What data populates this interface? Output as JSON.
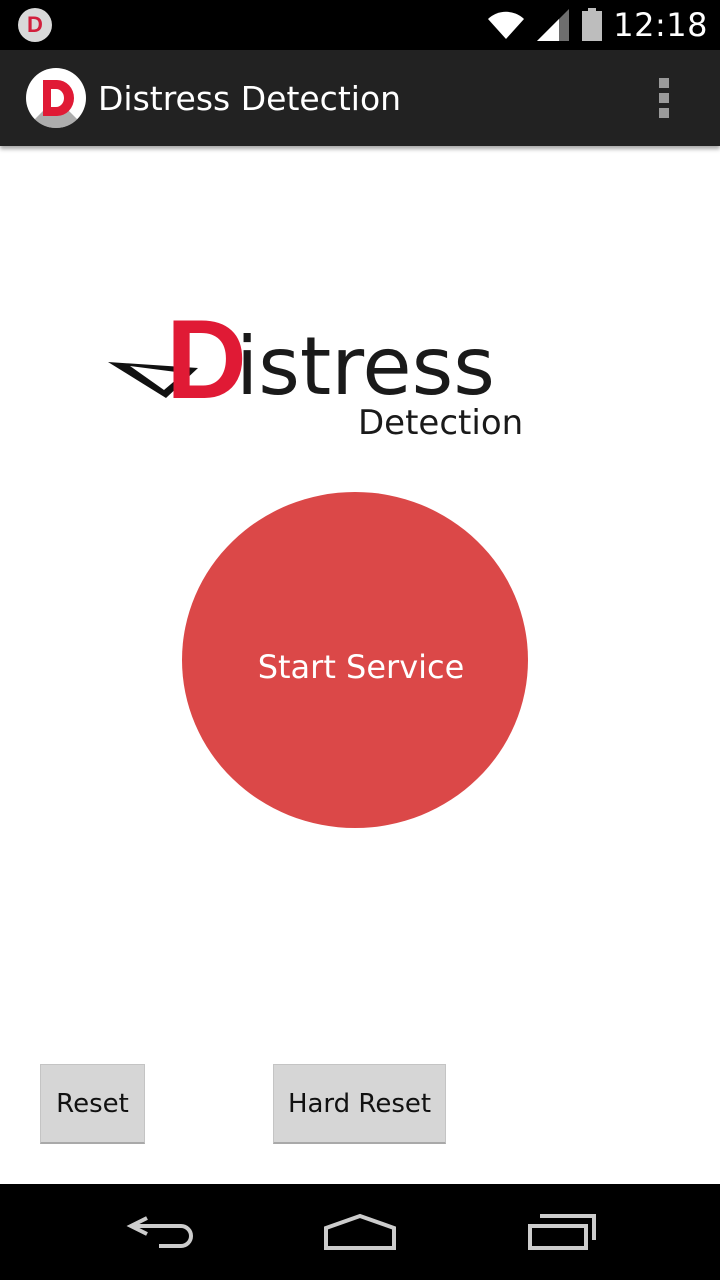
{
  "status_bar": {
    "notification_icon": "app-notification-icon",
    "notification_letter": "D",
    "time": "12:18",
    "icons": [
      "wifi-icon",
      "signal-icon",
      "battery-icon"
    ]
  },
  "action_bar": {
    "title": "Distress Detection",
    "app_icon": "app-logo-icon",
    "app_icon_letter": "D",
    "overflow_icon": "overflow-menu-icon"
  },
  "logo": {
    "initial": "D",
    "word_rest": "istress",
    "subtitle": "Detection",
    "brand_color": "#e01a35"
  },
  "main": {
    "start_button_label": "Start Service",
    "start_button_color": "#db4848"
  },
  "buttons": {
    "reset_label": "Reset",
    "hard_reset_label": "Hard Reset"
  },
  "nav_bar": {
    "icons": [
      "back-icon",
      "home-icon",
      "recent-apps-icon"
    ]
  }
}
